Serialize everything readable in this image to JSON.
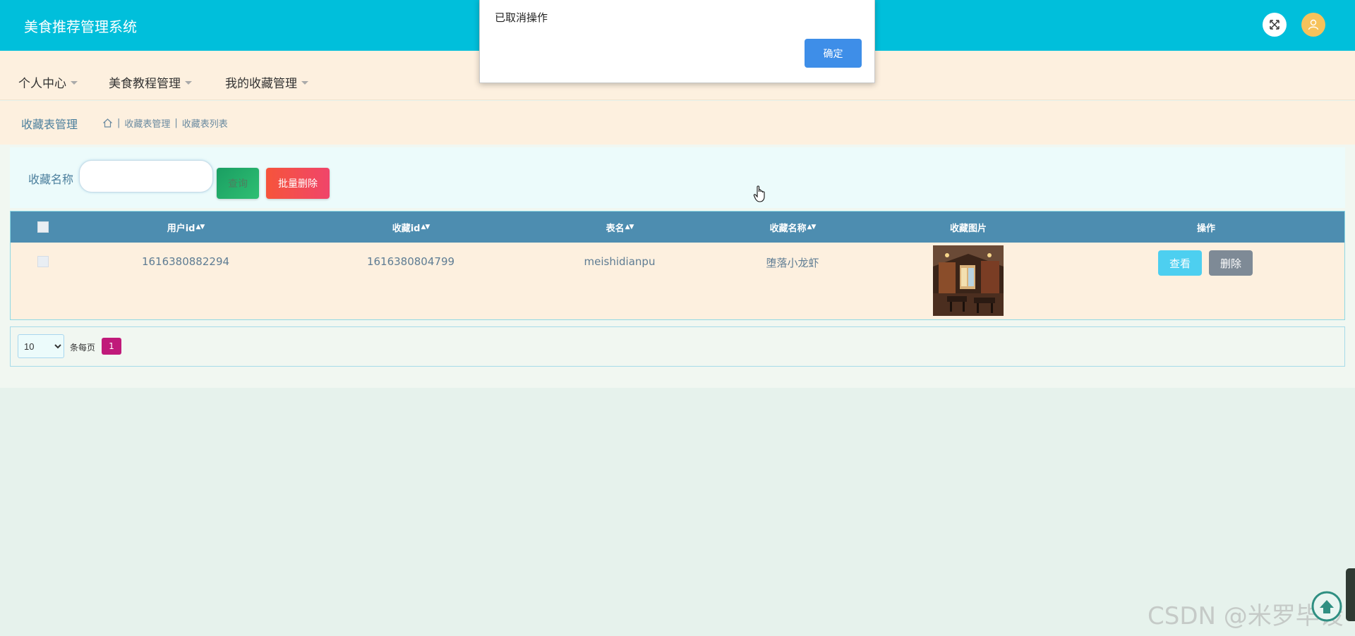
{
  "header": {
    "app_title": "美食推荐管理系统"
  },
  "nav": {
    "items": [
      {
        "label": "个人中心"
      },
      {
        "label": "美食教程管理"
      },
      {
        "label": "我的收藏管理"
      }
    ]
  },
  "breadcrumb": {
    "page_title": "收藏表管理",
    "items": [
      "收藏表管理",
      "收藏表列表"
    ]
  },
  "search": {
    "label": "收藏名称",
    "value": "",
    "placeholder": "",
    "query_button": "查询",
    "batch_delete_button": "批量删除"
  },
  "table": {
    "columns": [
      "用户id",
      "收藏id",
      "表名",
      "收藏名称",
      "收藏图片",
      "操作"
    ],
    "rows": [
      {
        "userid": "1616380882294",
        "refid": "1616380804799",
        "tablename": "meishidianpu",
        "name": "堕落小龙虾",
        "picture": "restaurant-photo",
        "view_label": "查看",
        "delete_label": "删除"
      }
    ]
  },
  "pagination": {
    "page_size": "10",
    "per_page_label": "条每页",
    "current_page": "1"
  },
  "dialog": {
    "message": "已取消操作",
    "ok_label": "确定"
  },
  "watermark": "CSDN @米罗毕设",
  "colors": {
    "header": "#00bfdb",
    "nav_bg": "#fdf0df",
    "table_header": "#4d8db0",
    "danger": "#f6543b",
    "view": "#4dcff0",
    "page_active": "#c01a7a",
    "dialog_ok": "#3e8ee8"
  },
  "icons": [
    "fullscreen-icon",
    "user-icon",
    "home-icon",
    "sort-icon",
    "hand-cursor-icon",
    "scroll-top-icon"
  ]
}
